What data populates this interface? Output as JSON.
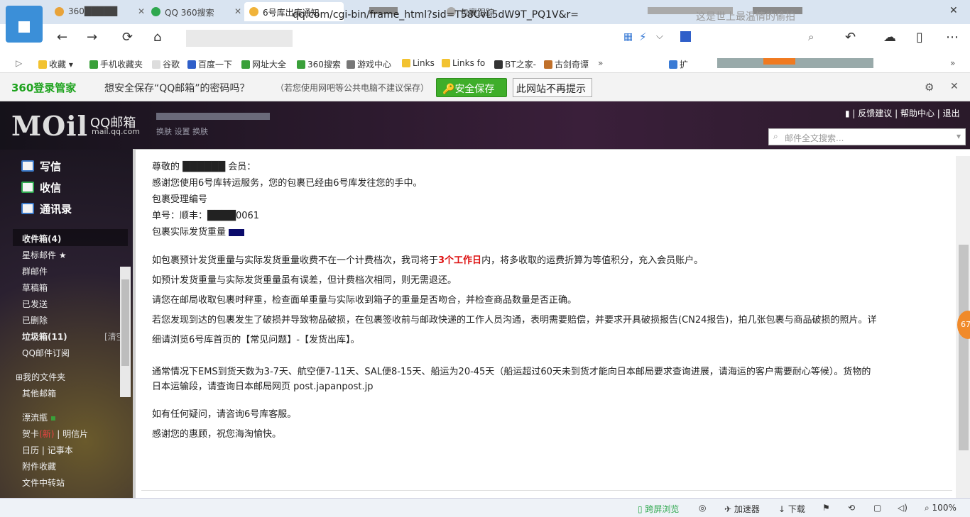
{
  "tabs": [
    {
      "label": "360█████"
    },
    {
      "label": "QQ 360搜索"
    },
    {
      "label": "6号库出库通知"
    },
    {
      "label": "包裹跟踪"
    }
  ],
  "address_bar": {
    "url": "qq.com/cgi-bin/frame_html?sid=T58CvL5dW9T_PQ1V&r="
  },
  "web_search": {
    "placeholder": "这是世上最温情的偷拍"
  },
  "bookmarks": [
    "收藏",
    "手机收藏夹",
    "谷歌",
    "百度一下",
    "网址大全",
    "360搜索",
    "游戏中心",
    "Links",
    "Links fo",
    "BT之家-",
    "古剑奇谭"
  ],
  "infobar": {
    "brand": "360登录管家",
    "question": "想安全保存“QQ邮箱”的密码吗？",
    "note": "（若您使用网吧等公共电脑不建议保存）",
    "save_button": "安全保存",
    "never_button": "此网站不再提示"
  },
  "mail_header": {
    "logo": "MOil",
    "brand": "QQ邮箱",
    "domain": "mail.qq.com",
    "links": "换肤  设置  换肤",
    "top_links": [
      "反馈建议",
      "帮助中心",
      "退出"
    ],
    "search_placeholder": "邮件全文搜索..."
  },
  "sidebar": {
    "write": "写信",
    "receive": "收信",
    "contacts": "通讯录",
    "inbox": "收件箱(4)",
    "starred": "星标邮件 ★",
    "group": "群邮件",
    "drafts": "草稿箱",
    "sent": "已发送",
    "deleted": "已删除",
    "spam": "垃圾箱(11)",
    "clear": "[清空]",
    "subscribe": "QQ邮件订阅",
    "my_folders": "我的文件夹",
    "other_mail": "其他邮箱",
    "drift": "漂流瓶",
    "card": "贺卡",
    "card_new": "(新)",
    "postcard": "明信片",
    "calendar": "日历",
    "notes": "记事本",
    "attachments": "附件收藏",
    "transfer": "文件中转站"
  },
  "email_body": {
    "l1": "尊敬的 ██████ 会员：",
    "l2": "感谢您使用6号库转运服务，您的包裹已经由6号库发往您的手中。",
    "l3": "包裹受理编号",
    "l4": "单号：顺丰：████0061",
    "l5": "包裹实际发货重量",
    "l6_pre": "如包裹预计发货重量与实际发货重量收费不在一个计费档次，我司将于",
    "l6_red": "3个工作日",
    "l6_post": "内，将多收取的运费折算为等值积分，充入会员账户。",
    "l7": "如预计发货重量与实际发货重量虽有误差，但计费档次相同，则无需退还。",
    "l8": "请您在邮局收取包裹时秤重，检查面单重量与实际收到箱子的重量是否吻合，并检查商品数量是否正确。",
    "l9": "若您发现到达的包裹发生了破损并导致物品破损，在包裹签收前与邮政快递的工作人员沟通，表明需要赔偿，并要求开具破损报告(CN24报告)，拍几张包裹与商品破损的照片。详",
    "l10": "细请浏览6号库首页的【常见问题】-【发货出库】。",
    "l11": "通常情况下EMS到货天数为3-7天、航空便7-11天、SAL便8-15天、船运为20-45天（船运超过60天未到货才能向日本邮局要求查询进展，请海运的客户需要耐心等候）。货物的",
    "l12": "日本运输段，请查询日本邮局网页 post.japanpost.jp",
    "l13": "如有任何疑问，请咨询6号库客服。",
    "l14": "感谢您的惠顾，祝您海淘愉快。"
  },
  "badge": "67",
  "status_bar": {
    "cross_screen": "跨屏浏览",
    "accelerator": "加速器",
    "download": "下载",
    "zoom": "100%"
  }
}
